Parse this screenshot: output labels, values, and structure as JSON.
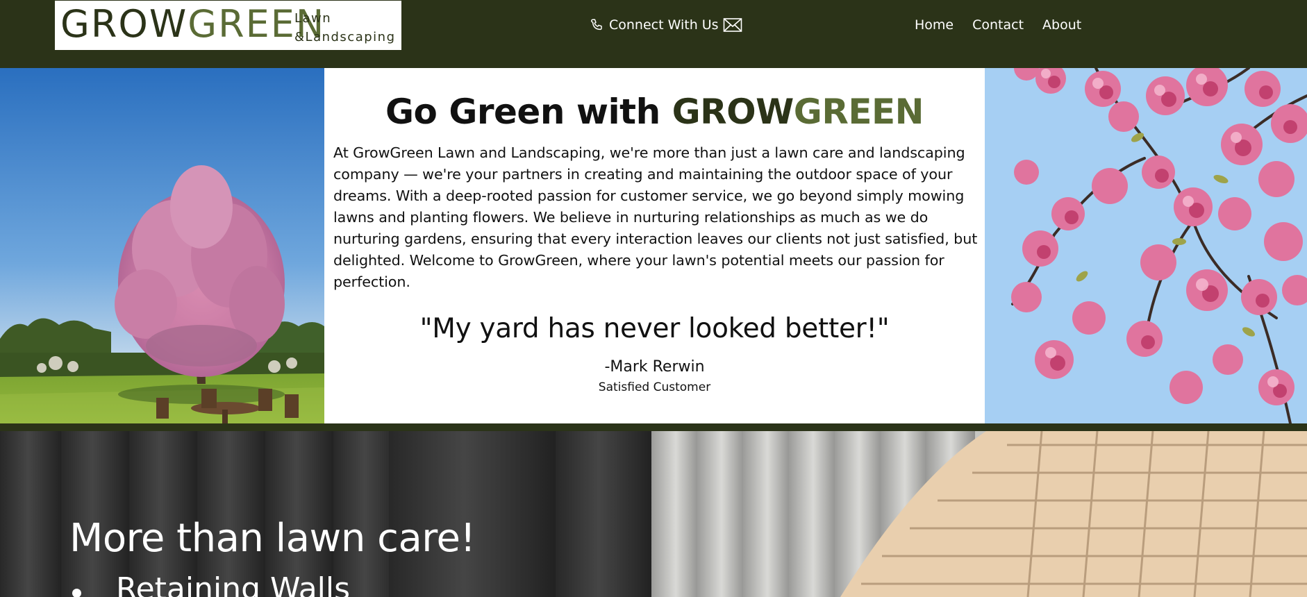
{
  "header": {
    "logo": {
      "grow": "GROW",
      "green": "GREEN",
      "sub_line1": "Lawn",
      "sub_line2": "&Landscaping"
    },
    "connect_label": "Connect With Us",
    "nav": [
      {
        "label": "Home"
      },
      {
        "label": "Contact"
      },
      {
        "label": "About"
      }
    ]
  },
  "hero": {
    "title_prefix": "Go Green with ",
    "title_brand_grow": "GROW",
    "title_brand_green": "GREEN",
    "intro": "At GrowGreen Lawn and Landscaping, we're more than just a lawn care and landscaping company — we're your partners in creating and maintaining the outdoor space of your dreams. With a deep-rooted passion for customer service, we go beyond simply mowing lawns and planting flowers. We believe in nurturing relationships as much as we do nurturing gardens, ensuring that every interaction leaves our clients not just satisfied, but delighted. Welcome to GrowGreen, where your lawn's potential meets our passion for perfection.",
    "quote": "\"My yard has never looked better!\"",
    "quote_author": "-Mark Rerwin",
    "quote_role": "Satisfied Customer"
  },
  "services": {
    "title": "More than lawn care!",
    "items": [
      {
        "label": "Retaining Walls"
      }
    ]
  },
  "colors": {
    "header_bg": "#2b3318",
    "brand_green": "#5a6b35",
    "sky_blue": "#a4cdf2"
  }
}
